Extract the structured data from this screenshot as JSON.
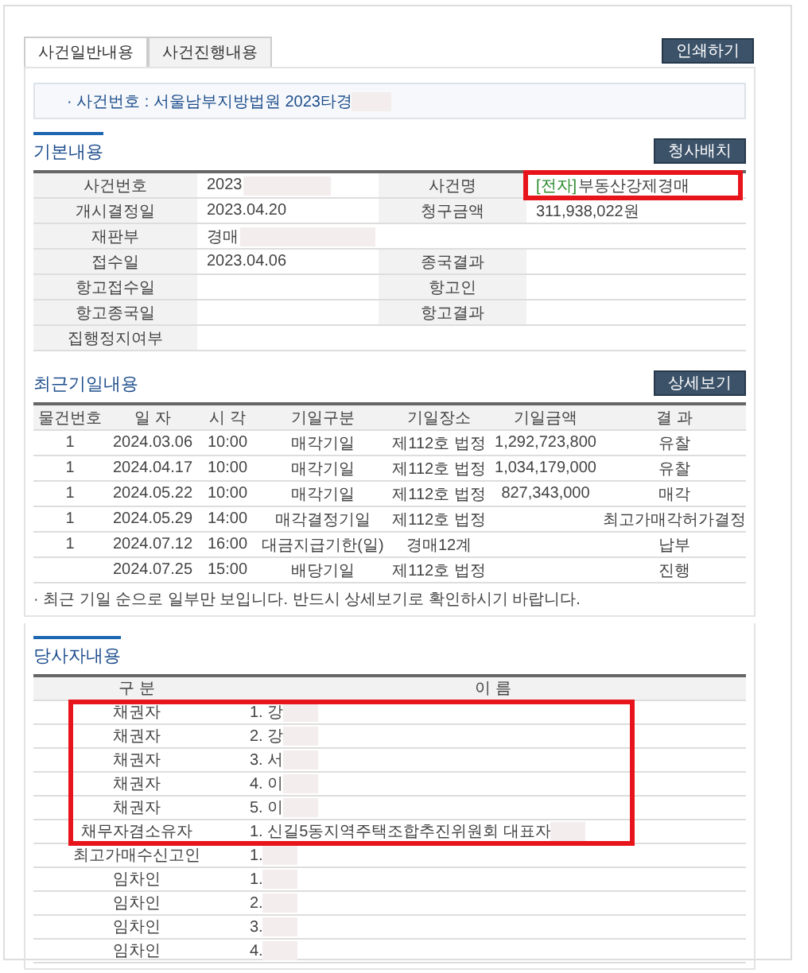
{
  "tabs": [
    {
      "label": "사건일반내용",
      "selected": true
    },
    {
      "label": "사건진행내용",
      "selected": false
    }
  ],
  "print_button": "인쇄하기",
  "case_banner": {
    "label": "· 사건번호 : 서울남부지방법원 2023타경",
    "redacted": true
  },
  "basic": {
    "title": "기본내용",
    "button": "청사배치",
    "rows": [
      {
        "cells": [
          {
            "label": "사건번호",
            "value": "2023",
            "redacted": true
          },
          {
            "label": "사건명",
            "tag": "[전자]",
            "value": "부동산강제경매",
            "highlighted": true
          }
        ]
      },
      {
        "cells": [
          {
            "label": "개시결정일",
            "value": "2023.04.20"
          },
          {
            "label": "청구금액",
            "value": "311,938,022원"
          }
        ]
      },
      {
        "cells": [
          {
            "label": "재판부",
            "value": "경매",
            "redacted": true
          }
        ]
      },
      {
        "cells": [
          {
            "label": "접수일",
            "value": "2023.04.06"
          },
          {
            "label": "종국결과"
          }
        ]
      },
      {
        "cells": [
          {
            "label": "항고접수일"
          },
          {
            "label": "항고인"
          }
        ]
      },
      {
        "cells": [
          {
            "label": "항고종국일"
          },
          {
            "label": "항고결과"
          }
        ]
      },
      {
        "cells": [
          {
            "label": "집행정지여부"
          }
        ]
      }
    ]
  },
  "schedule": {
    "title": "최근기일내용",
    "button": "상세보기",
    "columns": [
      "물건번호",
      "일 자",
      "시 각",
      "기일구분",
      "기일장소",
      "기일금액",
      "결 과"
    ],
    "rows": [
      [
        "1",
        "2024.03.06",
        "10:00",
        "매각기일",
        "제112호 법정",
        "1,292,723,800",
        "유찰"
      ],
      [
        "1",
        "2024.04.17",
        "10:00",
        "매각기일",
        "제112호 법정",
        "1,034,179,000",
        "유찰"
      ],
      [
        "1",
        "2024.05.22",
        "10:00",
        "매각기일",
        "제112호 법정",
        "827,343,000",
        "매각"
      ],
      [
        "1",
        "2024.05.29",
        "14:00",
        "매각결정기일",
        "제112호 법정",
        "",
        "최고가매각허가결정"
      ],
      [
        "1",
        "2024.07.12",
        "16:00",
        "대금지급기한(일)",
        "경매12계",
        "",
        "납부"
      ],
      [
        "",
        "2024.07.25",
        "15:00",
        "배당기일",
        "제112호 법정",
        "",
        "진행"
      ]
    ],
    "note": "· 최근 기일 순으로 일부만 보입니다. 반드시 상세보기로 확인하시기 바랍니다."
  },
  "parties": {
    "title": "당사자내용",
    "columns": [
      "구 분",
      "이 름"
    ],
    "highlighted_rows": [
      {
        "role": "채권자",
        "name": "1. 강",
        "redacted": true
      },
      {
        "role": "채권자",
        "name": "2. 강",
        "redacted": true
      },
      {
        "role": "채권자",
        "name": "3. 서",
        "redacted": true
      },
      {
        "role": "채권자",
        "name": "4. 이",
        "redacted": true
      },
      {
        "role": "채권자",
        "name": "5. 이",
        "redacted": true
      },
      {
        "role": "채무자겸소유자",
        "name": "1. 신길5동지역주택조합추진위원회 대표자",
        "redacted": true
      }
    ],
    "rows": [
      {
        "role": "최고가매수신고인",
        "name": "1.",
        "redacted": true
      },
      {
        "role": "임차인",
        "name": "1.",
        "redacted": true
      },
      {
        "role": "임차인",
        "name": "2.",
        "redacted": true
      },
      {
        "role": "임차인",
        "name": "3.",
        "redacted": true
      },
      {
        "role": "임차인",
        "name": "4.",
        "redacted": true
      }
    ]
  }
}
